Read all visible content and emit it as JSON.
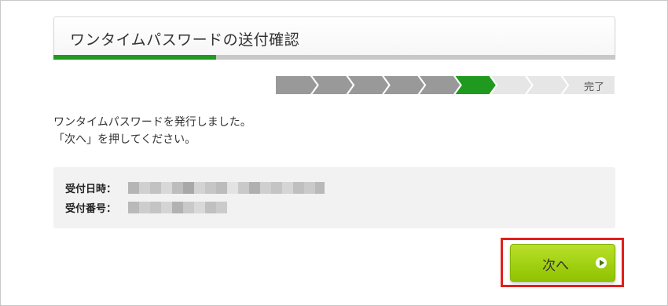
{
  "header": {
    "title": "ワンタイムパスワードの送付確認"
  },
  "progress": {
    "fraction": 0.29,
    "fill_color": "#1f9a1f",
    "track_color": "#c8c8c8"
  },
  "steps": {
    "total": 9,
    "current": 6,
    "final_label": "完了",
    "done_color": "#999999",
    "current_color": "#1f9a1f",
    "pending_color": "#e6e6e6"
  },
  "message": {
    "line1": "ワンタイムパスワードを発行しました。",
    "line2": "「次へ」を押してください。"
  },
  "info": {
    "received_datetime_label": "受付日時：",
    "receipt_number_label": "受付番号："
  },
  "actions": {
    "next_label": "次へ",
    "next_icon": "arrow-right-circle-icon",
    "button_color": "#9ccc00",
    "highlight_color": "#e0201c"
  }
}
